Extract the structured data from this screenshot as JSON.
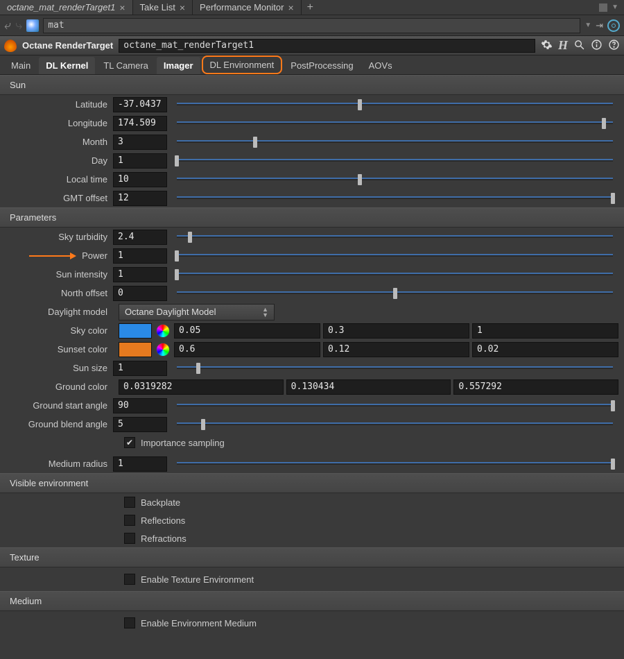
{
  "topTabs": {
    "active": "octane_mat_renderTarget1",
    "items": [
      "octane_mat_renderTarget1",
      "Take List",
      "Performance Monitor"
    ]
  },
  "nav": {
    "path_value": "mat"
  },
  "header": {
    "label": "Octane RenderTarget",
    "field_value": "octane_mat_renderTarget1"
  },
  "tabs": {
    "items": [
      "Main",
      "DL Kernel",
      "TL Camera",
      "Imager",
      "DL Environment",
      "PostProcessing",
      "AOVs"
    ],
    "selected": [
      "DL Kernel",
      "Imager"
    ],
    "highlighted": "DL Environment"
  },
  "sections": {
    "sun": {
      "title": "Sun",
      "latitude": {
        "label": "Latitude",
        "value": "-37.0437",
        "pos": 42
      },
      "longitude": {
        "label": "Longitude",
        "value": "174.509",
        "pos": 98
      },
      "month": {
        "label": "Month",
        "value": "3",
        "pos": 18
      },
      "day": {
        "label": "Day",
        "value": "1",
        "pos": 0
      },
      "local_time": {
        "label": "Local time",
        "value": "10",
        "pos": 42
      },
      "gmt_offset": {
        "label": "GMT offset",
        "value": "12",
        "pos": 100
      }
    },
    "parameters": {
      "title": "Parameters",
      "sky_turbidity": {
        "label": "Sky turbidity",
        "value": "2.4",
        "pos": 3
      },
      "power": {
        "label": "Power",
        "value": "1",
        "pos": 0
      },
      "sun_intensity": {
        "label": "Sun intensity",
        "value": "1",
        "pos": 0
      },
      "north_offset": {
        "label": "North offset",
        "value": "0",
        "pos": 50
      },
      "daylight_model": {
        "label": "Daylight model",
        "value": "Octane Daylight Model"
      },
      "sky_color": {
        "label": "Sky color",
        "swatch": "#2a8ae6",
        "r": "0.05",
        "g": "0.3",
        "b": "1"
      },
      "sunset_color": {
        "label": "Sunset color",
        "swatch": "#e67a1f",
        "r": "0.6",
        "g": "0.12",
        "b": "0.02"
      },
      "sun_size": {
        "label": "Sun size",
        "value": "1",
        "pos": 5
      },
      "ground_color": {
        "label": "Ground color",
        "r": "0.0319282",
        "g": "0.130434",
        "b": "0.557292"
      },
      "ground_start": {
        "label": "Ground start angle",
        "value": "90",
        "pos": 100
      },
      "ground_blend": {
        "label": "Ground blend angle",
        "value": "5",
        "pos": 6
      },
      "importance": {
        "label": "Importance sampling",
        "checked": true
      },
      "medium_radius": {
        "label": "Medium radius",
        "value": "1",
        "pos": 100
      }
    },
    "visible_env": {
      "title": "Visible environment",
      "backplate": {
        "label": "Backplate",
        "checked": false
      },
      "reflections": {
        "label": "Reflections",
        "checked": false
      },
      "refractions": {
        "label": "Refractions",
        "checked": false
      }
    },
    "texture": {
      "title": "Texture",
      "enable": {
        "label": "Enable Texture Environment",
        "checked": false
      }
    },
    "medium": {
      "title": "Medium",
      "enable": {
        "label": "Enable Environment Medium",
        "checked": false
      }
    }
  }
}
